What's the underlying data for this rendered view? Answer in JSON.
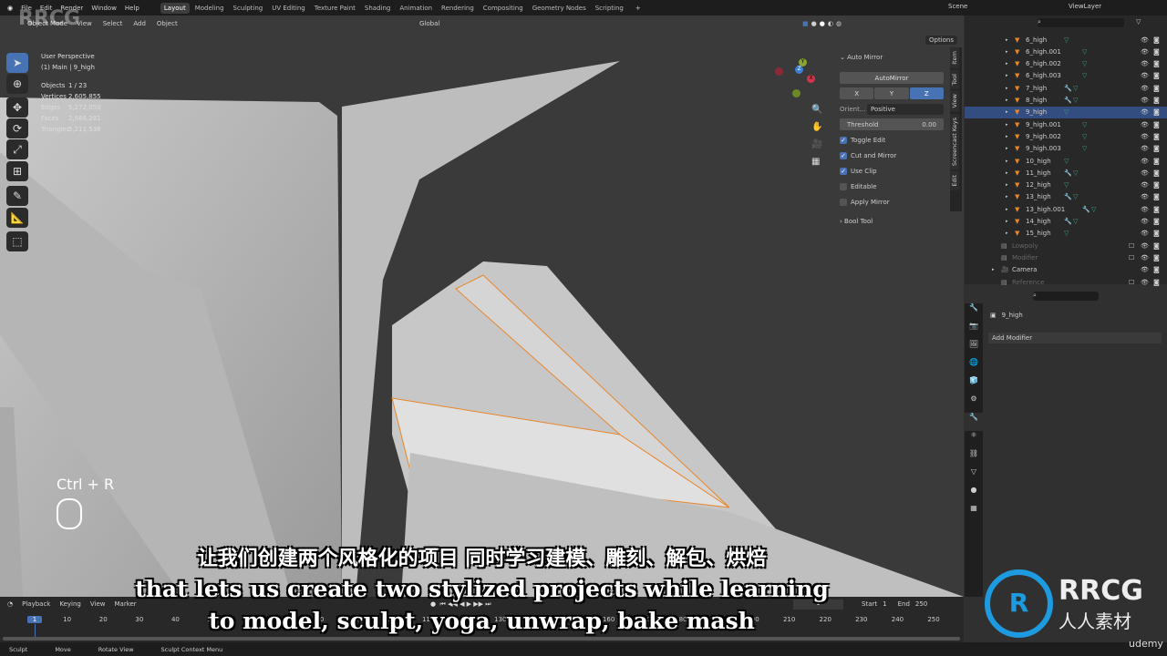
{
  "menu": [
    "File",
    "Edit",
    "Render",
    "Window",
    "Help"
  ],
  "workspaces": [
    {
      "label": "Layout",
      "active": true
    },
    {
      "label": "Modeling"
    },
    {
      "label": "Sculpting"
    },
    {
      "label": "UV Editing"
    },
    {
      "label": "Texture Paint"
    },
    {
      "label": "Shading"
    },
    {
      "label": "Animation"
    },
    {
      "label": "Rendering"
    },
    {
      "label": "Compositing"
    },
    {
      "label": "Geometry Nodes"
    },
    {
      "label": "Scripting"
    }
  ],
  "add_workspace": "+",
  "scene": "Scene",
  "view_layer": "ViewLayer",
  "viewport_header": {
    "mode": "Object Mode",
    "menus": [
      "View",
      "Select",
      "Add",
      "Object"
    ],
    "transform": "Global",
    "options": "Options"
  },
  "overlay": {
    "perspective": "User Perspective",
    "context": "(1) Main | 9_high",
    "stats": [
      [
        "Objects",
        "1 / 23"
      ],
      [
        "Vertices",
        "2,605,855"
      ],
      [
        "Edges",
        "5,272,050"
      ],
      [
        "Faces",
        "2,666,281"
      ],
      [
        "Triangles",
        "5,211,538"
      ]
    ]
  },
  "gizmo": {
    "axes": [
      "X",
      "Y",
      "Z"
    ]
  },
  "keyhint": "Ctrl + R",
  "npanel": {
    "title": "Auto Mirror",
    "button": "AutoMirror",
    "axes": [
      "X",
      "Y",
      "Z"
    ],
    "active_axis": "Z",
    "orient_label": "Orient...",
    "orient_value": "Positive",
    "threshold_label": "Threshold",
    "threshold_value": "0.00",
    "checks": [
      {
        "label": "Toggle Edit",
        "on": true
      },
      {
        "label": "Cut and Mirror",
        "on": true
      },
      {
        "label": "Use Clip",
        "on": true
      },
      {
        "label": "Editable",
        "on": false
      },
      {
        "label": "Apply Mirror",
        "on": false
      }
    ],
    "bool_tool": "Bool Tool",
    "tabs": [
      "Item",
      "Tool",
      "View",
      "Screencast Keys",
      "Edit"
    ]
  },
  "outliner": {
    "rows": [
      {
        "name": "6_high"
      },
      {
        "name": "6_high.001"
      },
      {
        "name": "6_high.002"
      },
      {
        "name": "6_high.003"
      },
      {
        "name": "7_high",
        "mod": true
      },
      {
        "name": "8_high",
        "mod": true
      },
      {
        "name": "9_high",
        "selected": true
      },
      {
        "name": "9_high.001"
      },
      {
        "name": "9_high.002"
      },
      {
        "name": "9_high.003"
      },
      {
        "name": "10_high"
      },
      {
        "name": "11_high",
        "mod": true
      },
      {
        "name": "12_high"
      },
      {
        "name": "13_high",
        "mod": true
      },
      {
        "name": "13_high.001",
        "mod": true
      },
      {
        "name": "14_high",
        "mod": true
      },
      {
        "name": "15_high"
      },
      {
        "name": "Lowpoly",
        "collection": true
      },
      {
        "name": "Modifier",
        "collection": true
      },
      {
        "name": "Camera",
        "camera": true
      },
      {
        "name": "Reference",
        "collection": true
      }
    ]
  },
  "properties": {
    "object": "9_high",
    "add_modifier": "Add Modifier"
  },
  "timeline": {
    "menus": [
      "Playback",
      "Keying",
      "View",
      "Marker"
    ],
    "current_frame": "1",
    "start_label": "Start",
    "start": "1",
    "end_label": "End",
    "end": "250",
    "ticks": [
      "1",
      "10",
      "20",
      "30",
      "40",
      "50",
      "60",
      "70",
      "80",
      "90",
      "100",
      "110",
      "120",
      "130",
      "140",
      "150",
      "160",
      "170",
      "180",
      "190",
      "200",
      "210",
      "220",
      "230",
      "240",
      "250"
    ]
  },
  "status": [
    "Sculpt",
    "Move",
    "Rotate View",
    "Sculpt Context Menu"
  ],
  "subtitles": {
    "zh": "让我们创建两个风格化的项目 同时学习建模、雕刻、解包、烘焙",
    "en1": "that lets us create two stylized projects while learning",
    "en2": "to model, sculpt, yoga, unwrap, bake mash"
  },
  "watermark": {
    "logo": "RRCG",
    "logo_sub": "人人素材",
    "brand": "udemy"
  },
  "colors": {
    "accent": "#4772b3",
    "selection": "#334d80",
    "object_orange": "#e8862a",
    "mesh_green": "#3ea37c"
  }
}
